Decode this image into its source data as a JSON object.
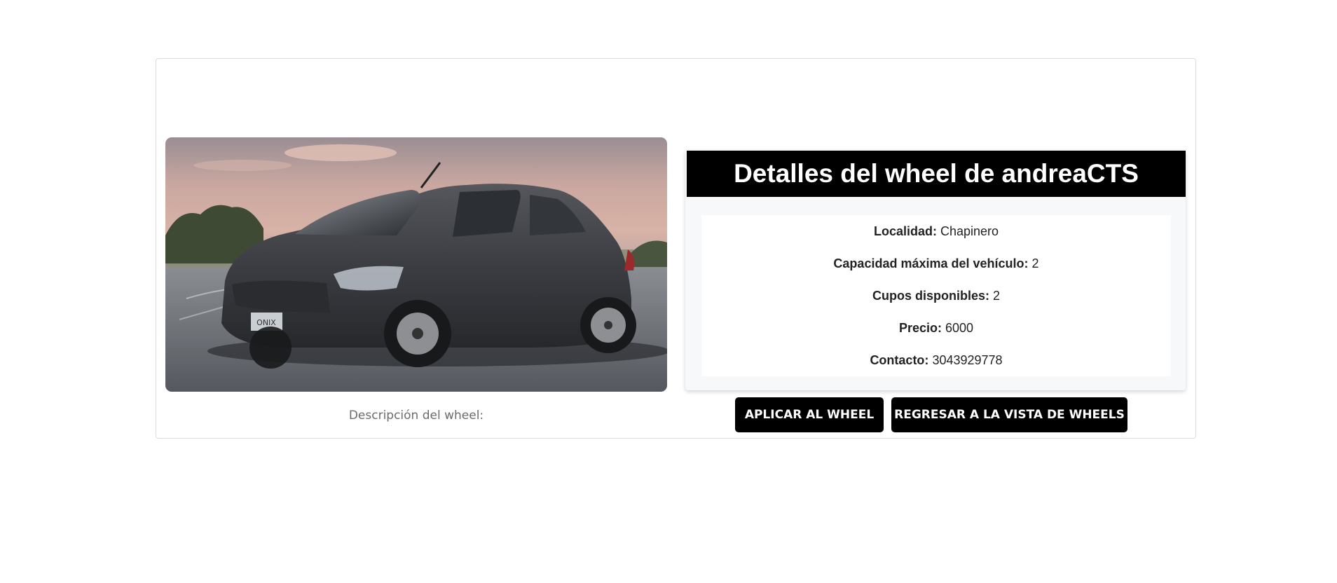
{
  "panel": {
    "title": "Detalles del wheel de andreaCTS"
  },
  "details": [
    {
      "label": "Localidad:",
      "value": "Chapinero"
    },
    {
      "label": "Capacidad máxima del vehículo:",
      "value": "2"
    },
    {
      "label": "Cupos disponibles:",
      "value": "2"
    },
    {
      "label": "Precio:",
      "value": "6000"
    },
    {
      "label": "Contacto:",
      "value": "3043929778"
    }
  ],
  "photo": {
    "icon": "car-photo",
    "plate_text": "ONIX"
  },
  "description_label": "Descripción del wheel:",
  "actions": {
    "apply_label": "APLICAR AL WHEEL",
    "back_label": "REGRESAR A LA VISTA DE WHEELS"
  }
}
